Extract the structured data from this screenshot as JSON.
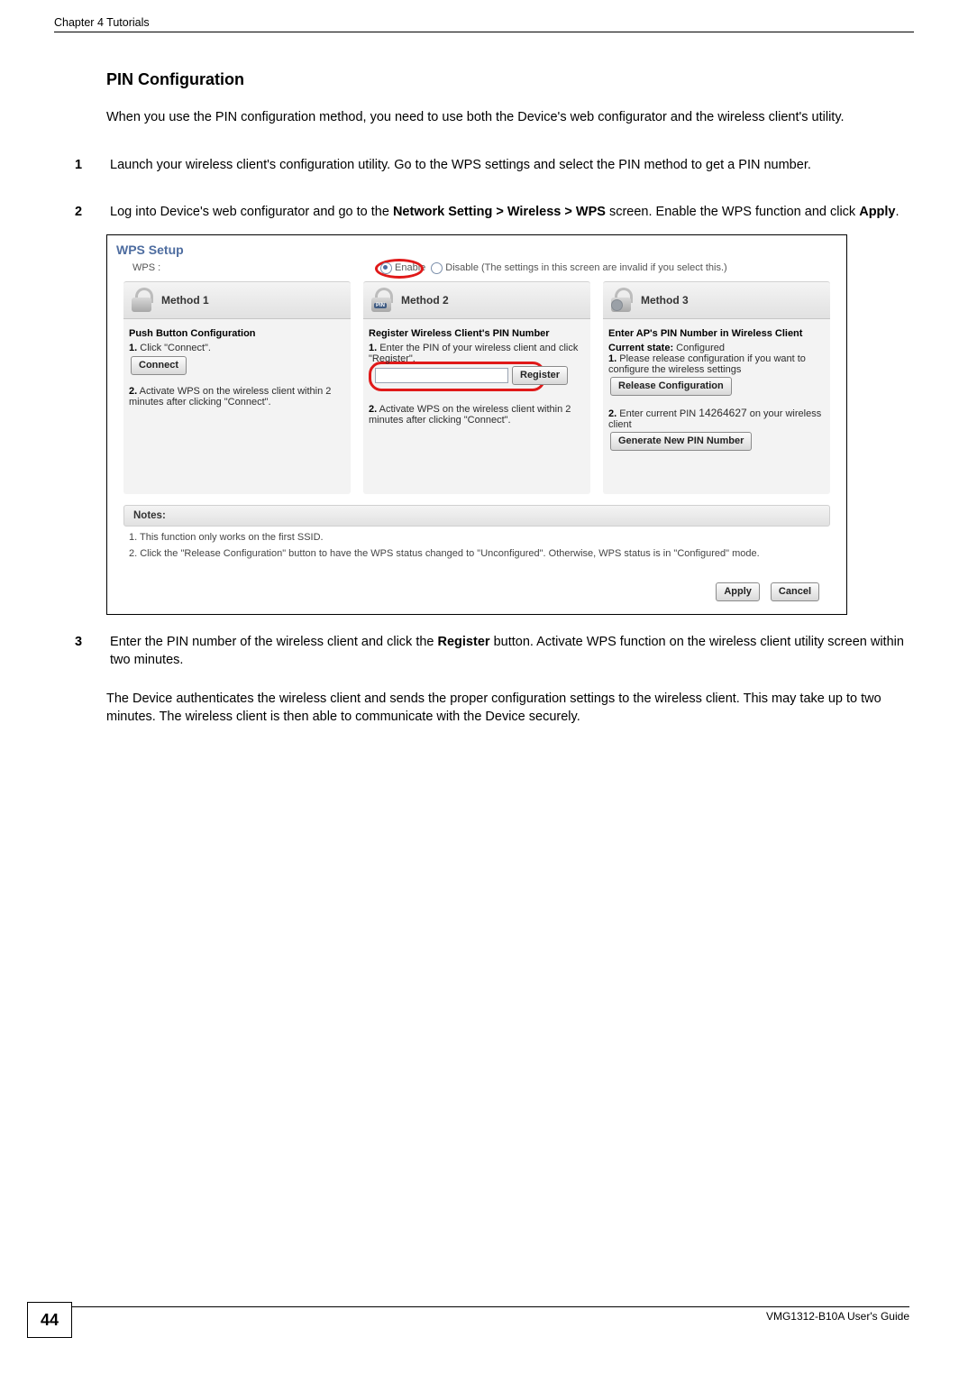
{
  "running_header": "Chapter 4 Tutorials",
  "section_title": "PIN Configuration",
  "intro": "When you use the PIN configuration method, you need to use both the Device's web configurator and the wireless client's utility.",
  "steps": {
    "s1": {
      "num": "1",
      "text": "Launch your wireless client's configuration utility. Go to the WPS settings and select the PIN method to get a PIN number."
    },
    "s2": {
      "num": "2",
      "pre": "Log into Device's web configurator and go to the ",
      "bold1": "Network Setting > Wireless > WPS",
      "mid": " screen. Enable the WPS function and click ",
      "bold2": "Apply",
      "post": "."
    },
    "s3": {
      "num": "3",
      "pre": "Enter the PIN number of the wireless client and click the ",
      "bold1": "Register",
      "post": " button. Activate WPS function on the wireless client utility screen within two minutes."
    }
  },
  "after_text": "The Device authenticates the wireless client and sends the proper configuration settings to the wireless client. This may take up to two minutes. The wireless client is then able to communicate with the Device securely.",
  "figure": {
    "setup_title": "WPS Setup",
    "wps_label": "WPS :",
    "enable_label": "Enable",
    "disable_label": "Disable (The settings in this screen are invalid if you select this.)",
    "method1": {
      "title": "Method 1",
      "heading": "Push Button Configuration",
      "step1b": "1.",
      "step1t": " Click \"Connect\".",
      "connect_btn": "Connect",
      "step2b": "2.",
      "step2t": " Activate WPS on the wireless client within 2 minutes after clicking \"Connect\"."
    },
    "method2": {
      "title": "Method 2",
      "pin_tag": "PIN",
      "heading": "Register Wireless Client's PIN Number",
      "step1b": "1.",
      "step1t": " Enter the PIN of your wireless client and click \"Register\".",
      "register_btn": "Register",
      "step2b": "2.",
      "step2t": " Activate WPS on the wireless client within 2 minutes after clicking \"Connect\"."
    },
    "method3": {
      "title": "Method 3",
      "heading": "Enter AP's PIN Number in Wireless Client",
      "state_lbl": "Current state:",
      "state_val": " Configured",
      "step1b": "1.",
      "step1t": " Please release configuration if you want to configure the wireless settings",
      "release_btn": "Release Configuration",
      "step2b": "2.",
      "step2t_pre": " Enter current PIN ",
      "pin": "14264627",
      "step2t_post": " on your wireless client",
      "gen_btn": "Generate New PIN Number"
    },
    "notes": {
      "title": "Notes:",
      "n1": "1. This function only works on the first SSID.",
      "n2": "2. Click the \"Release Configuration\" button to have the WPS status changed to \"Unconfigured\". Otherwise, WPS status is in \"Configured\" mode."
    },
    "footer": {
      "apply": "Apply",
      "cancel": "Cancel"
    }
  },
  "page_footer": {
    "num": "44",
    "guide": "VMG1312-B10A User's Guide"
  }
}
